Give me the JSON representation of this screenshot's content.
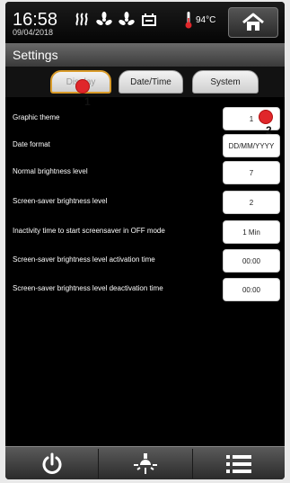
{
  "status": {
    "time": "16:58",
    "date": "09/04/2018",
    "temperature": "94°C",
    "icons": [
      "heating-icon",
      "fan-icon",
      "fan-icon",
      "alarm-icon"
    ]
  },
  "title": "Settings",
  "tabs": [
    {
      "label": "Display",
      "active": true
    },
    {
      "label": "Date/Time",
      "active": false
    },
    {
      "label": "System",
      "active": false
    }
  ],
  "settings": [
    {
      "label": "Graphic theme",
      "value": "1"
    },
    {
      "label": "Date format",
      "value": "DD/MM/YYYY"
    },
    {
      "label": "Normal brightness level",
      "value": "7"
    },
    {
      "label": "Screen-saver brightness level",
      "value": "2"
    },
    {
      "label": "Inactivity time to start screensaver in OFF mode",
      "value": "1 Min"
    },
    {
      "label": "Screen-saver brightness level activation time",
      "value": "00:00"
    },
    {
      "label": "Screen-saver brightness level deactivation time",
      "value": "00:00"
    }
  ],
  "callouts": [
    {
      "number": "1"
    },
    {
      "number": "2"
    }
  ],
  "colors": {
    "active_tab_border": "#d99b2a",
    "callout": "#e0262a"
  },
  "bottom_buttons": [
    "power-icon",
    "lamp-icon",
    "menu-icon"
  ]
}
